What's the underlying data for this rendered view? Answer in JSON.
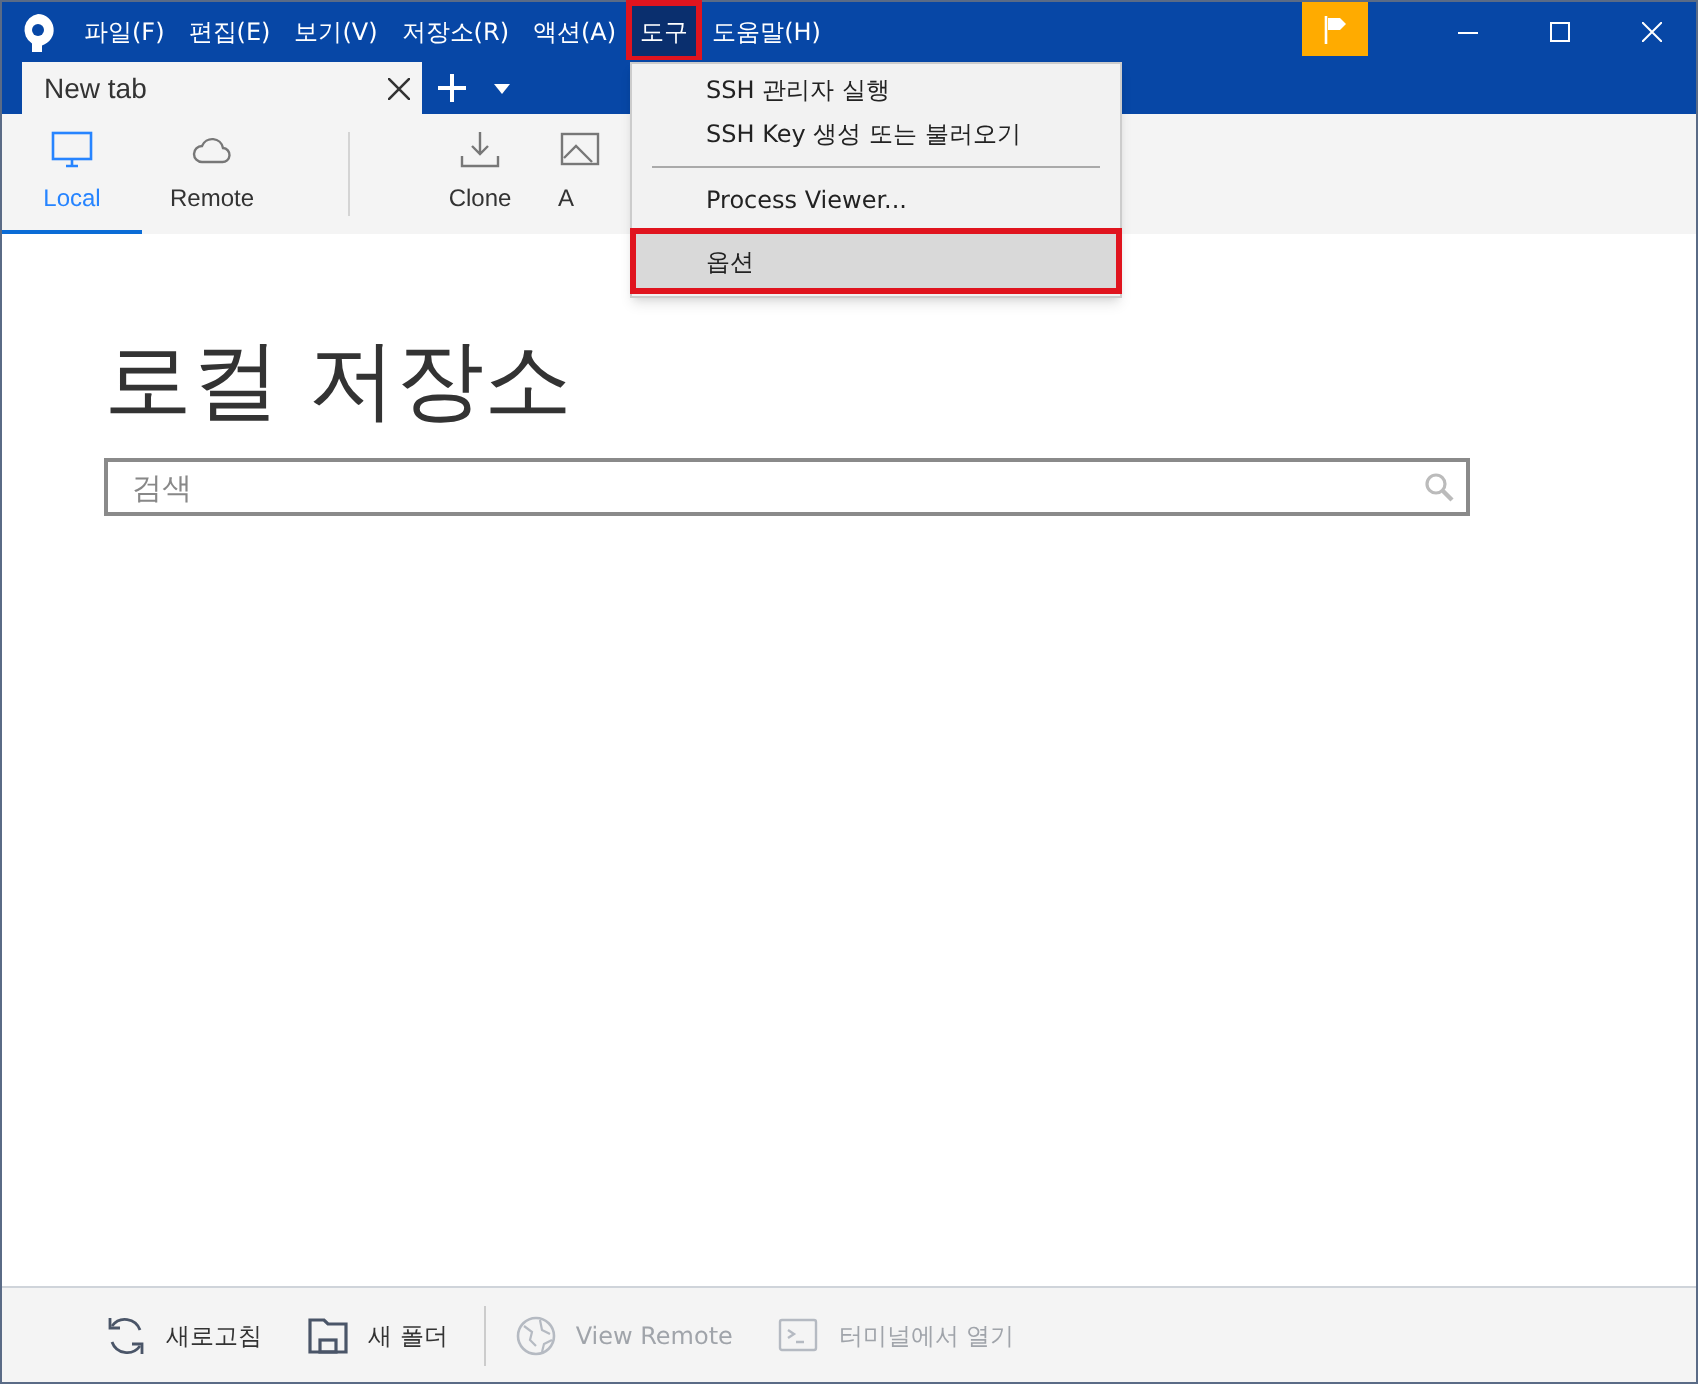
{
  "menu_bar": [
    {
      "label": "파일(F)",
      "highlighted": false
    },
    {
      "label": "편집(E)",
      "highlighted": false
    },
    {
      "label": "보기(V)",
      "highlighted": false
    },
    {
      "label": "저장소(R)",
      "highlighted": false
    },
    {
      "label": "액션(A)",
      "highlighted": false
    },
    {
      "label": "도구",
      "highlighted": true
    },
    {
      "label": "도움말(H)",
      "highlighted": false
    }
  ],
  "tabs": [
    {
      "label": "New tab",
      "selected": true
    }
  ],
  "toolbar": [
    {
      "label": "Local",
      "kind": "monitor",
      "selected": true
    },
    {
      "label": "Remote",
      "kind": "cloud",
      "selected": false
    },
    {
      "label": "Clone",
      "kind": "download",
      "selected": false
    },
    {
      "label": "A",
      "kind": "image",
      "selected": false
    }
  ],
  "dropdown": [
    {
      "kind": "item",
      "label": "SSH 관리자 실행",
      "highlighted": false
    },
    {
      "kind": "item",
      "label": "SSH Key 생성 또는 불러오기",
      "highlighted": false
    },
    {
      "kind": "separator"
    },
    {
      "kind": "item",
      "label": "Process Viewer...",
      "highlighted": false
    },
    {
      "kind": "item",
      "label": "옵션",
      "highlighted": true
    }
  ],
  "heading": "로컬 저장소",
  "search": {
    "placeholder": "검색"
  },
  "footer": [
    {
      "label": "새로고침",
      "kind": "refresh",
      "disabled": false
    },
    {
      "label": "새 폴더",
      "kind": "folder",
      "disabled": false
    },
    {
      "label": "View Remote",
      "kind": "globe",
      "disabled": true
    },
    {
      "label": "터미널에서 열기",
      "kind": "terminal",
      "disabled": true
    }
  ]
}
